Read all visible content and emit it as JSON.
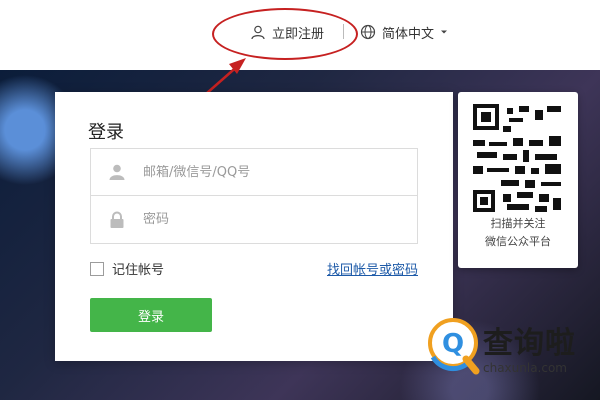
{
  "topbar": {
    "register_label": "立即注册",
    "language_label": "简体中文"
  },
  "login": {
    "title": "登录",
    "username_placeholder": "邮箱/微信号/QQ号",
    "password_placeholder": "密码",
    "remember_label": "记住帐号",
    "forgot_label": "找回帐号或密码",
    "submit_label": "登录",
    "button_color": "#44b549"
  },
  "qr": {
    "line1": "扫描并关注",
    "line2": "微信公众平台"
  },
  "watermark": {
    "brand": "查询啦",
    "domain": "chaxunla.com"
  },
  "annotation": {
    "color": "#c62121"
  }
}
